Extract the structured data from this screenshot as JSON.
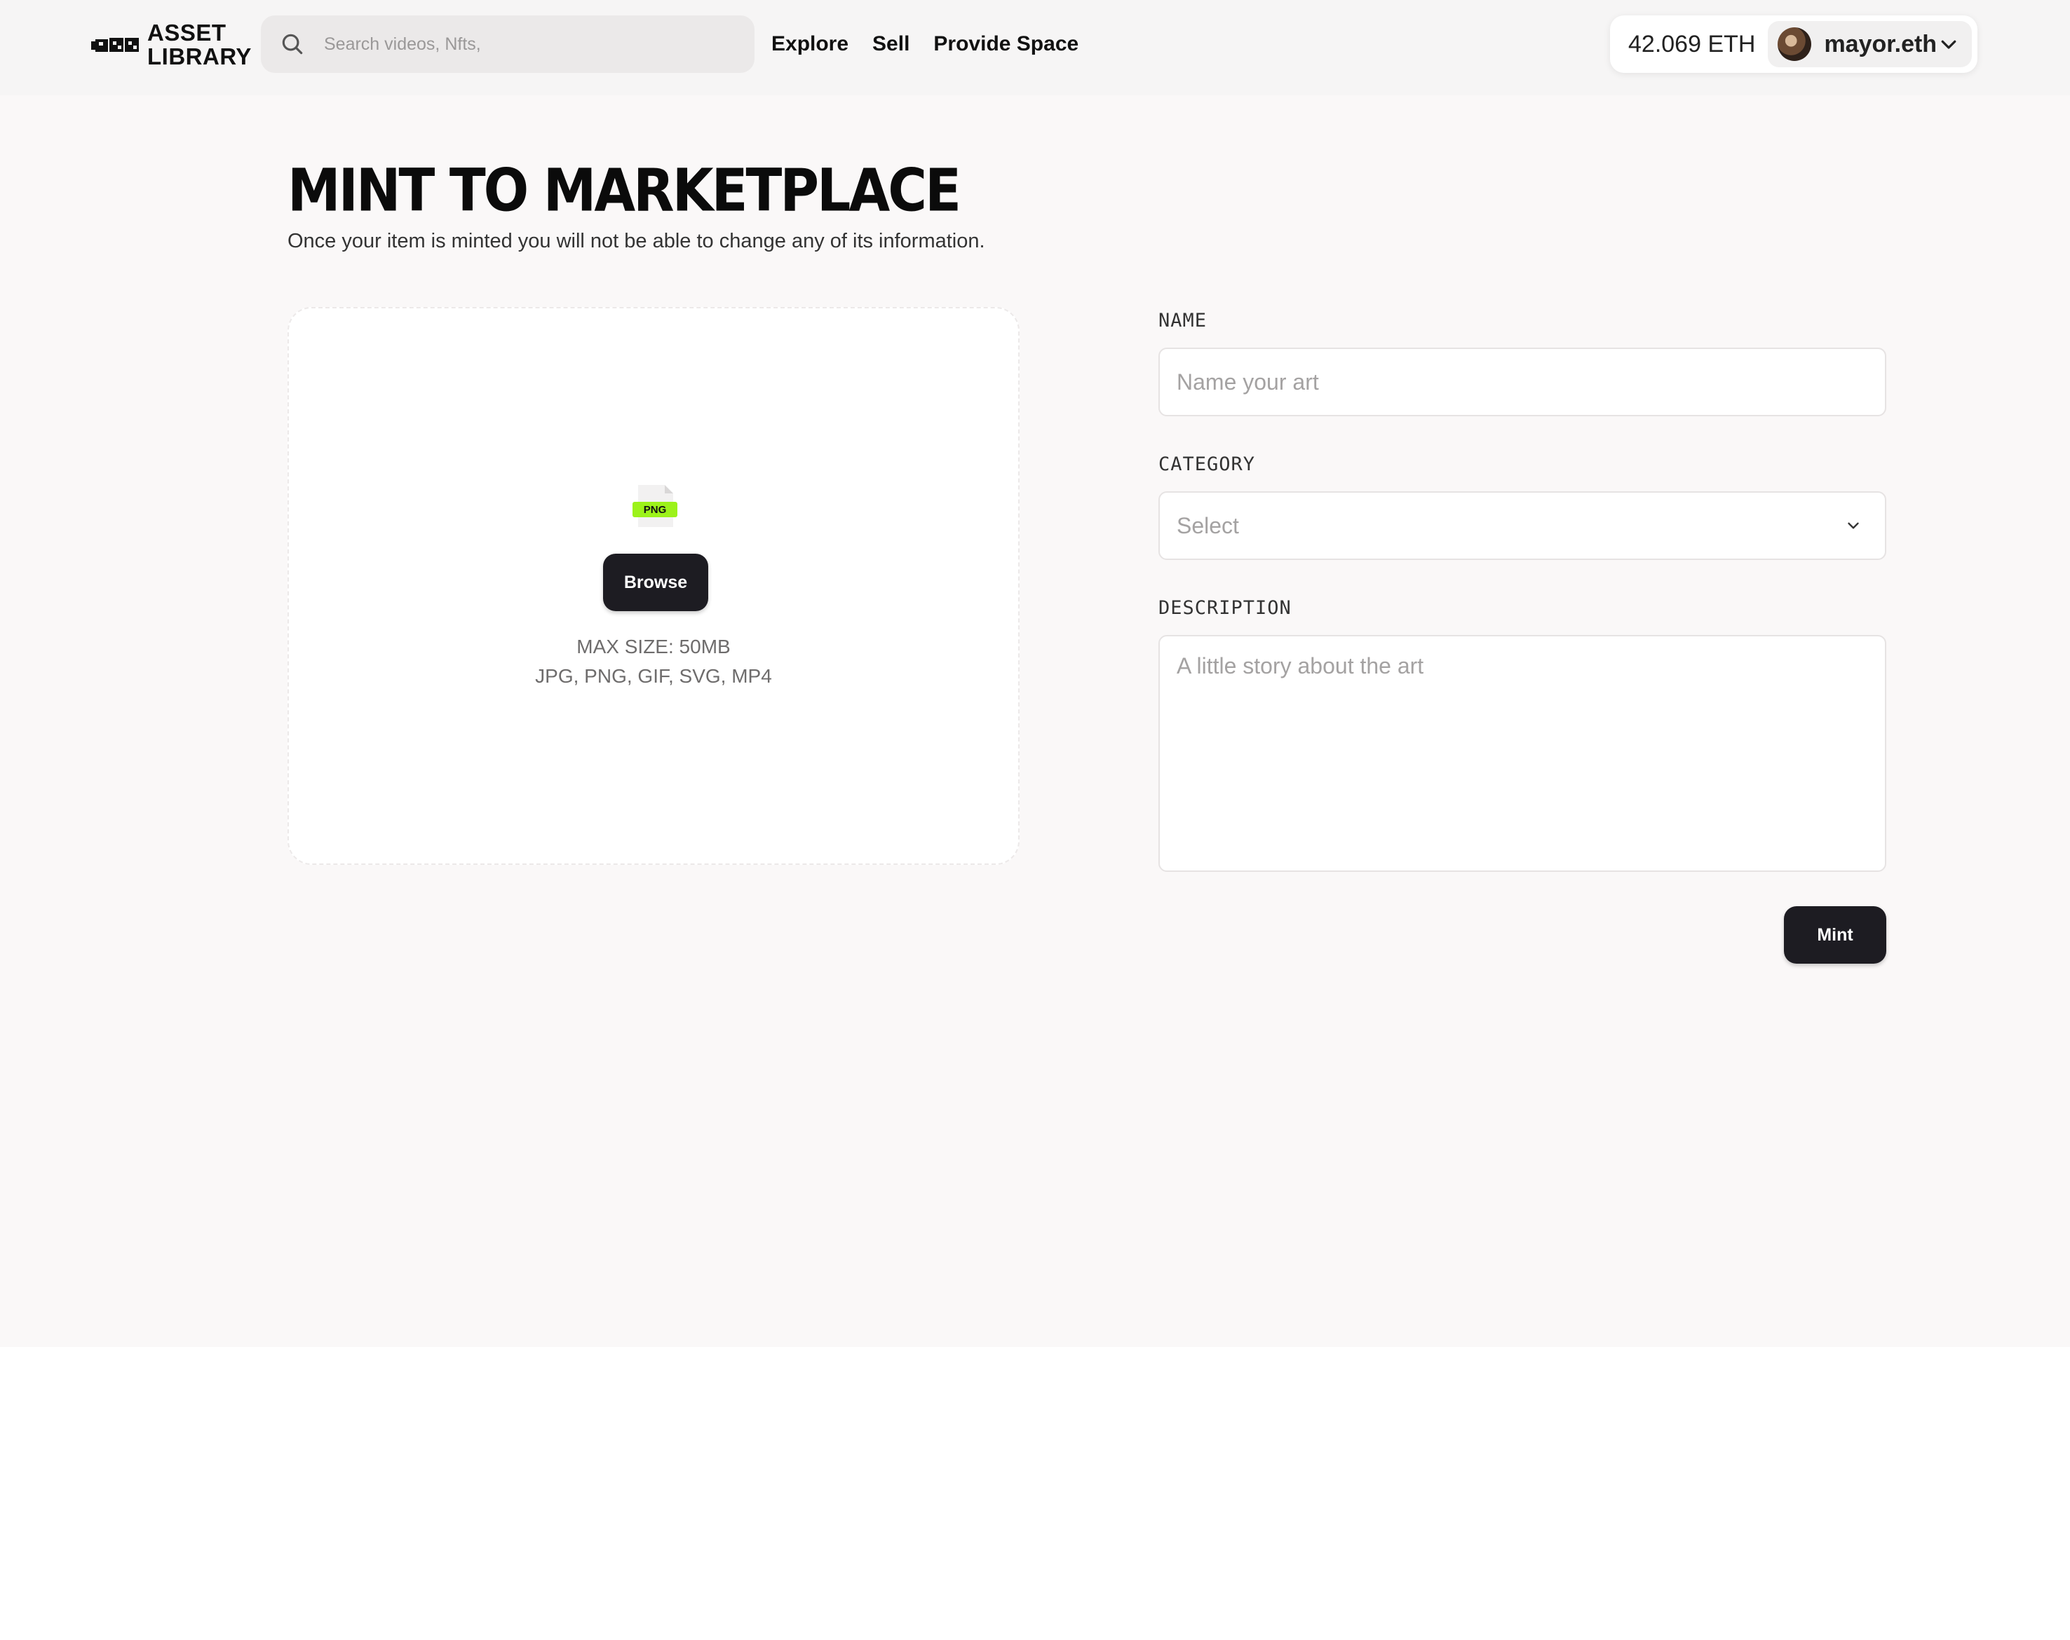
{
  "app": {
    "logo_line1": "ASSET",
    "logo_line2": "LIBRARY"
  },
  "header": {
    "search_placeholder": "Search videos, Nfts,",
    "nav": [
      "Explore",
      "Sell",
      "Provide Space"
    ],
    "balance": "42.069 ETH",
    "account_name": "mayor.eth"
  },
  "page": {
    "title": "MINT TO MARKETPLACE",
    "subtitle": "Once your item is minted you will not be able to change any of its information."
  },
  "upload": {
    "file_badge": "PNG",
    "browse_label": "Browse",
    "max_size": "MAX SIZE: 50MB",
    "formats": "JPG, PNG, GIF, SVG, MP4"
  },
  "form": {
    "name_label": "NAME",
    "name_placeholder": "Name your art",
    "category_label": "CATEGORY",
    "category_value": "Select",
    "description_label": "DESCRIPTION",
    "description_placeholder": "A little story about the art",
    "submit_label": "Mint"
  },
  "colors": {
    "header_bg": "#f6f5f5",
    "page_bg": "#faf8f8",
    "button_dark": "#1d1c22",
    "png_badge": "#9cf21a"
  },
  "icons": {
    "search": "search-icon",
    "chevron": "chevron-down-icon",
    "file": "png-file-icon"
  }
}
